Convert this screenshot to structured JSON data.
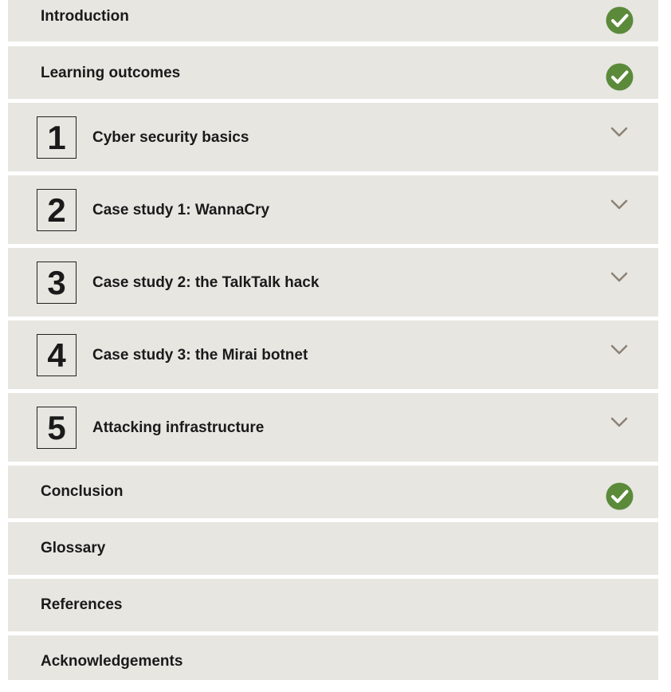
{
  "toc": {
    "introduction": {
      "label": "Introduction",
      "completed": true,
      "status_icon": "check-circle-icon"
    },
    "learning_outcomes": {
      "label": "Learning outcomes",
      "completed": true,
      "status_icon": "check-circle-icon"
    },
    "sections": [
      {
        "number": "1",
        "label": "Cyber security basics",
        "expand_icon": "chevron-down-icon"
      },
      {
        "number": "2",
        "label": "Case study 1: WannaCry",
        "expand_icon": "chevron-down-icon"
      },
      {
        "number": "3",
        "label": "Case study 2: the TalkTalk hack",
        "expand_icon": "chevron-down-icon"
      },
      {
        "number": "4",
        "label": "Case study 3: the Mirai botnet",
        "expand_icon": "chevron-down-icon"
      },
      {
        "number": "5",
        "label": "Attacking infrastructure",
        "expand_icon": "chevron-down-icon"
      }
    ],
    "conclusion": {
      "label": "Conclusion",
      "completed": true,
      "status_icon": "check-circle-icon"
    },
    "glossary": {
      "label": "Glossary"
    },
    "references": {
      "label": "References"
    },
    "acknowledgements": {
      "label": "Acknowledgements"
    }
  },
  "colors": {
    "row_background": "#e7e6e1",
    "page_background": "#ffffff",
    "check_green": "#5b8a3a",
    "chevron_gray": "#8c8276",
    "text": "#1a1a1a"
  }
}
